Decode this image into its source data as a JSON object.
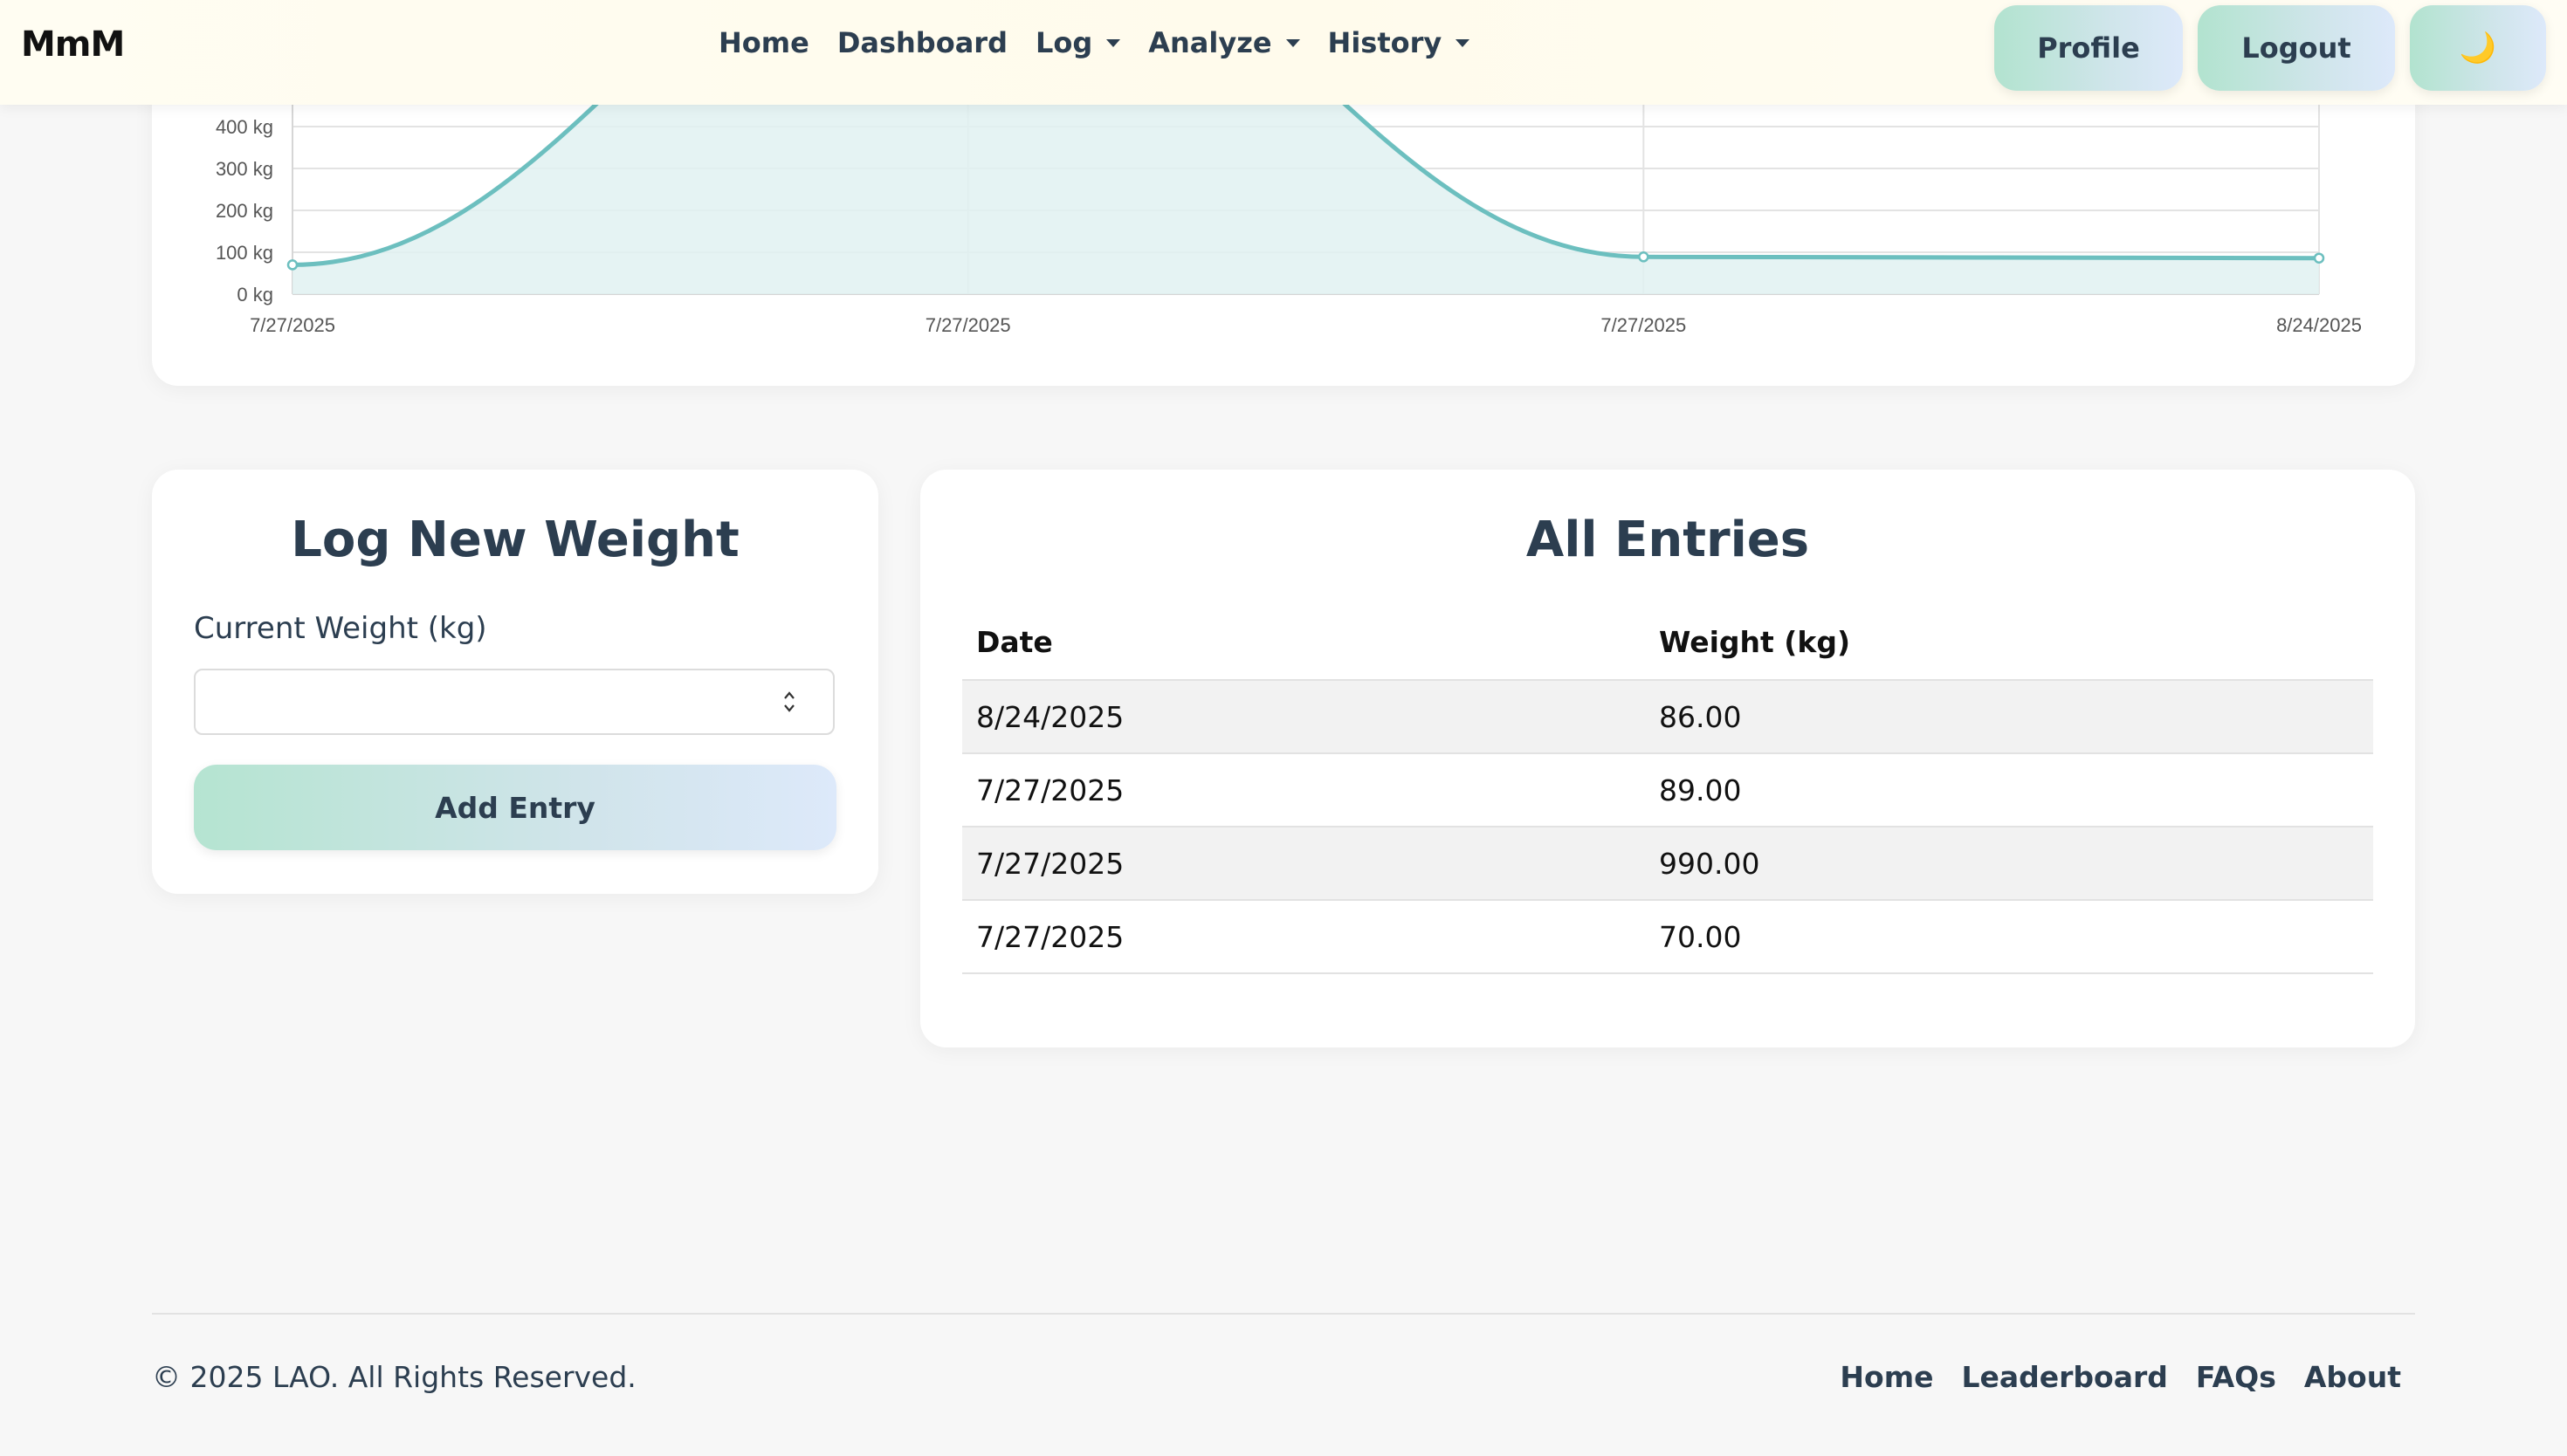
{
  "nav": {
    "brand": "MmM",
    "links": [
      "Home",
      "Dashboard",
      "Log",
      "Analyze",
      "History"
    ],
    "profile_label": "Profile",
    "logout_label": "Logout",
    "theme_icon": "moon-icon",
    "theme_glyph": "🌙"
  },
  "chart_data": {
    "type": "area",
    "x": [
      "7/27/2025",
      "7/27/2025",
      "7/27/2025",
      "7/27/2025",
      "8/24/2025"
    ],
    "x_tick_labels": [
      "7/27/2025",
      "7/27/2025",
      "7/27/2025",
      "8/24/2025"
    ],
    "series": [
      {
        "values": [
          70,
          990,
          89,
          86
        ]
      }
    ],
    "y_tick_labels": [
      "0 kg",
      "100 kg",
      "200 kg",
      "300 kg",
      "400 kg"
    ],
    "y_ticks": [
      0,
      100,
      200,
      300,
      400
    ],
    "ylim": [
      0,
      400
    ],
    "grid": true,
    "color": "#6cbfbf",
    "fill": "#e0f1f1"
  },
  "log_form": {
    "title": "Log New Weight",
    "label": "Current Weight (kg)",
    "value": "",
    "button": "Add Entry"
  },
  "entries": {
    "title": "All Entries",
    "headers": [
      "Date",
      "Weight (kg)"
    ],
    "rows": [
      [
        "8/24/2025",
        "86.00"
      ],
      [
        "7/27/2025",
        "89.00"
      ],
      [
        "7/27/2025",
        "990.00"
      ],
      [
        "7/27/2025",
        "70.00"
      ]
    ]
  },
  "footer": {
    "copyright": "© 2025 LAO. All Rights Reserved.",
    "links": [
      "Home",
      "Leaderboard",
      "FAQs",
      "About"
    ]
  }
}
